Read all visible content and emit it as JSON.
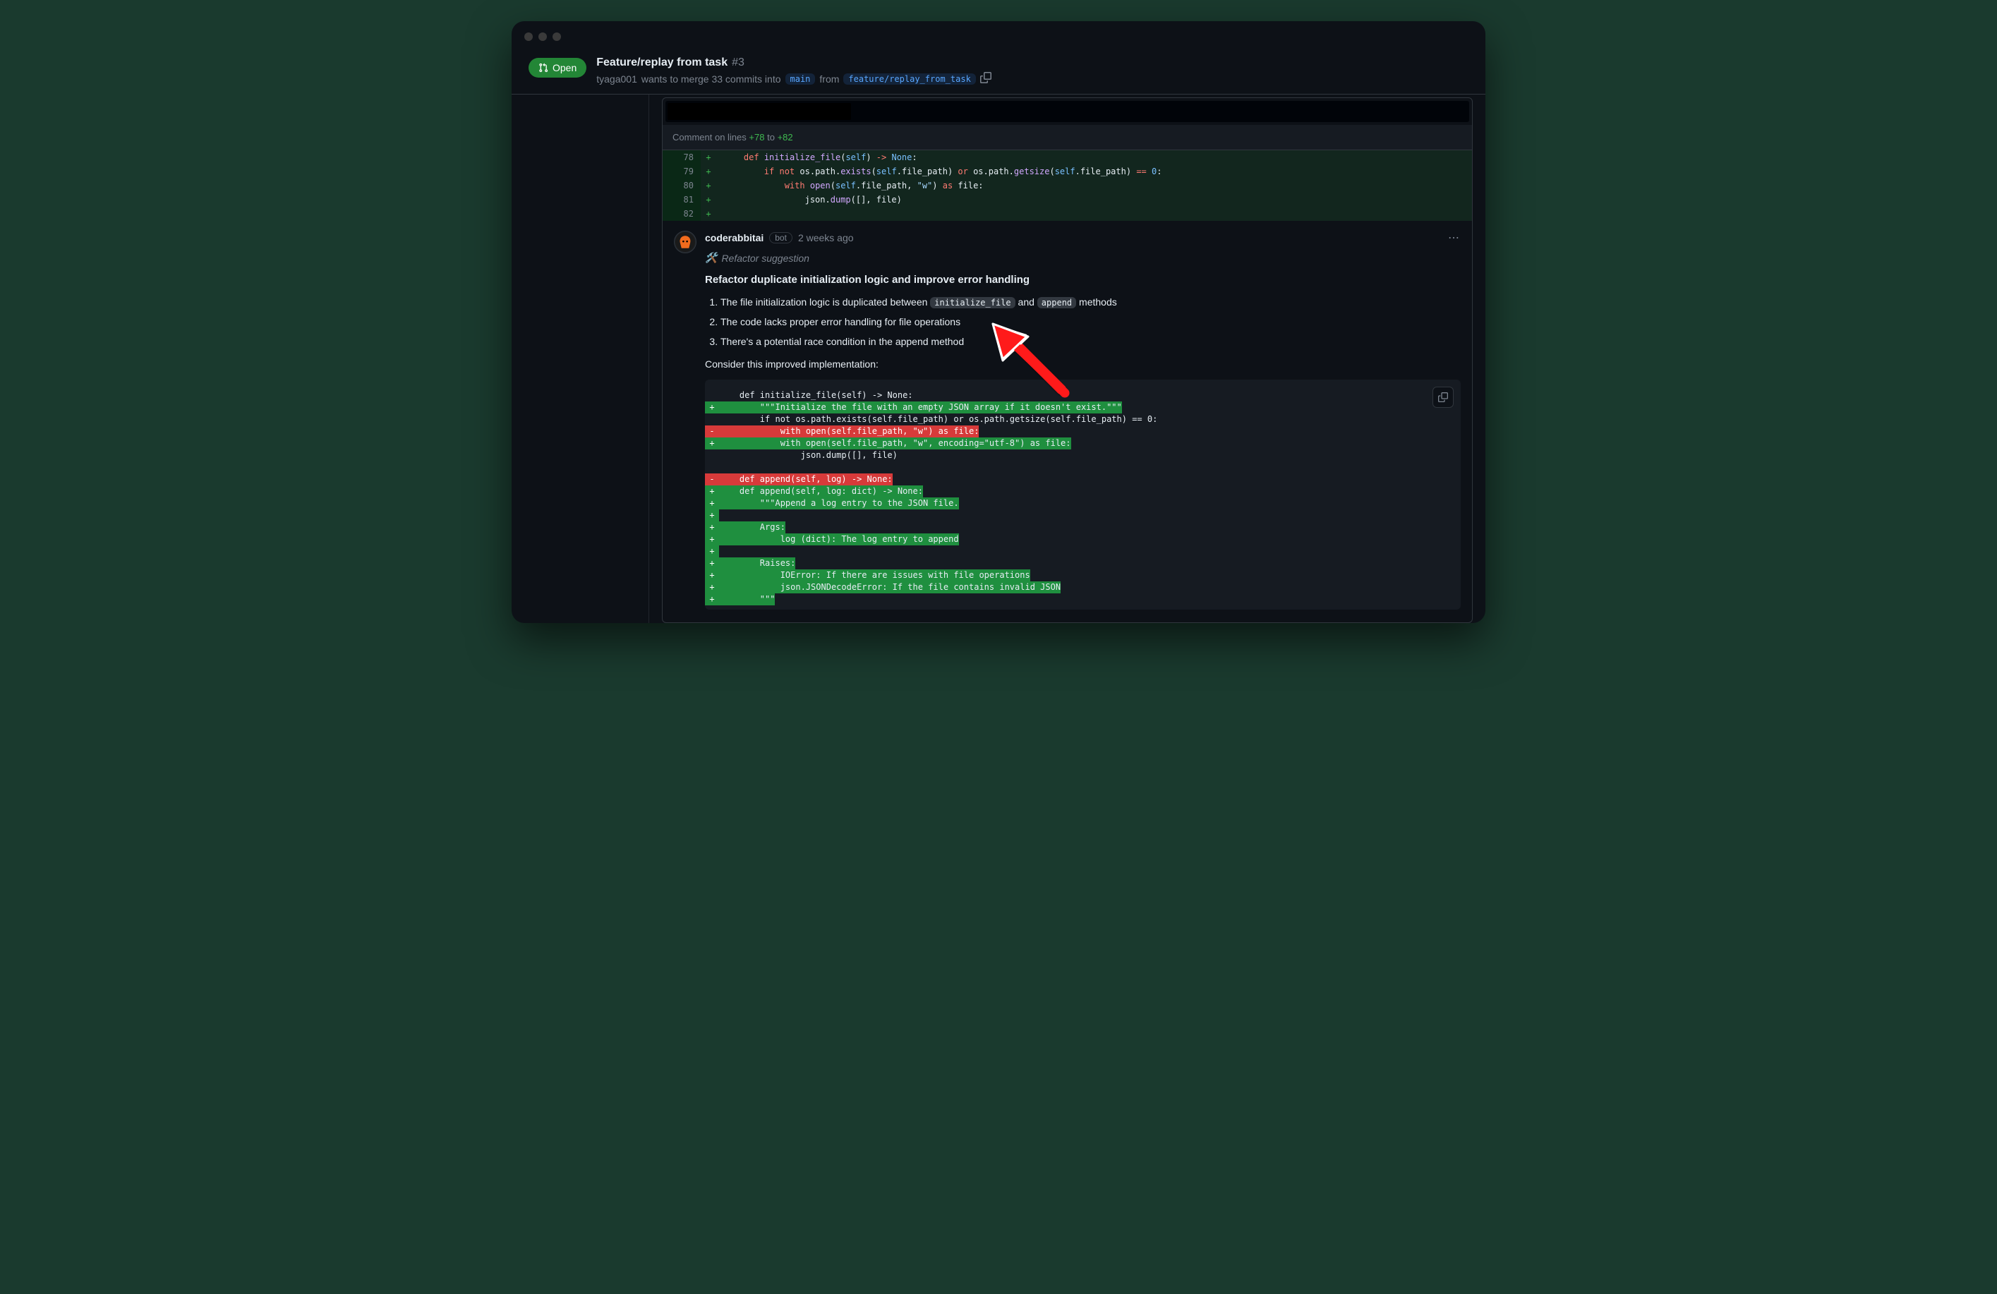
{
  "status": {
    "label": "Open"
  },
  "pr": {
    "title": "Feature/replay from task",
    "number": "#3",
    "user": "tyaga001",
    "merge_text_pre": "wants to merge 33 commits into",
    "base_branch": "main",
    "from_label": "from",
    "head_branch": "feature/replay_from_task"
  },
  "lines_comment": {
    "prefix": "Comment on lines",
    "from": "+78",
    "to_label": "to",
    "to": "+82"
  },
  "code": {
    "rows": [
      {
        "n": "78",
        "m": "+",
        "html": "    <span class='tok-kw'>def</span> <span class='tok-fn'>initialize_file</span>(<span class='tok-self'>self</span>) <span class='tok-op'>-&gt;</span> <span class='tok-const'>None</span>:"
      },
      {
        "n": "79",
        "m": "+",
        "html": "        <span class='tok-kw'>if</span> <span class='tok-kw'>not</span> os.path.<span class='tok-fn'>exists</span>(<span class='tok-self'>self</span>.file_path) <span class='tok-kw'>or</span> os.path.<span class='tok-fn'>getsize</span>(<span class='tok-self'>self</span>.file_path) <span class='tok-op'>==</span> <span class='tok-num'>0</span>:"
      },
      {
        "n": "80",
        "m": "+",
        "html": "            <span class='tok-kw'>with</span> <span class='tok-fn'>open</span>(<span class='tok-self'>self</span>.file_path, <span class='tok-str'>\"w\"</span>) <span class='tok-kw'>as</span> file:"
      },
      {
        "n": "81",
        "m": "+",
        "html": "                json.<span class='tok-fn'>dump</span>([], file)"
      },
      {
        "n": "82",
        "m": "+",
        "html": ""
      }
    ]
  },
  "comment": {
    "author": "coderabbitai",
    "bot_label": "bot",
    "timestamp": "2 weeks ago",
    "suggest_icon": "🛠️",
    "suggest_label": "Refactor suggestion",
    "title": "Refactor duplicate initialization logic and improve error handling",
    "points": {
      "p1_pre": "The file initialization logic is duplicated between ",
      "p1_code1": "initialize_file",
      "p1_mid": " and ",
      "p1_code2": "append",
      "p1_post": " methods",
      "p2": "The code lacks proper error handling for file operations",
      "p3": "There's a potential race condition in the append method"
    },
    "consider": "Consider this improved implementation:"
  },
  "diff": {
    "lines": [
      {
        "t": "ctx",
        "s": " ",
        "c": "    def initialize_file(self) -> None:"
      },
      {
        "t": "add",
        "s": "+",
        "c": "        \"\"\"Initialize the file with an empty JSON array if it doesn't exist.\"\"\""
      },
      {
        "t": "ctx",
        "s": " ",
        "c": "        if not os.path.exists(self.file_path) or os.path.getsize(self.file_path) == 0:"
      },
      {
        "t": "del",
        "s": "-",
        "c": "            with open(self.file_path, \"w\") as file:"
      },
      {
        "t": "add",
        "s": "+",
        "c": "            with open(self.file_path, \"w\", encoding=\"utf-8\") as file:"
      },
      {
        "t": "ctx",
        "s": " ",
        "c": "                json.dump([], file)"
      },
      {
        "t": "ctx",
        "s": " ",
        "c": ""
      },
      {
        "t": "del",
        "s": "-",
        "c": "    def append(self, log) -> None:"
      },
      {
        "t": "add",
        "s": "+",
        "c": "    def append(self, log: dict) -> None:"
      },
      {
        "t": "add",
        "s": "+",
        "c": "        \"\"\"Append a log entry to the JSON file."
      },
      {
        "t": "add",
        "s": "+",
        "c": ""
      },
      {
        "t": "add",
        "s": "+",
        "c": "        Args:"
      },
      {
        "t": "add",
        "s": "+",
        "c": "            log (dict): The log entry to append"
      },
      {
        "t": "add",
        "s": "+",
        "c": ""
      },
      {
        "t": "add",
        "s": "+",
        "c": "        Raises:"
      },
      {
        "t": "add",
        "s": "+",
        "c": "            IOError: If there are issues with file operations"
      },
      {
        "t": "add",
        "s": "+",
        "c": "            json.JSONDecodeError: If the file contains invalid JSON"
      },
      {
        "t": "add",
        "s": "+",
        "c": "        \"\"\""
      }
    ]
  }
}
